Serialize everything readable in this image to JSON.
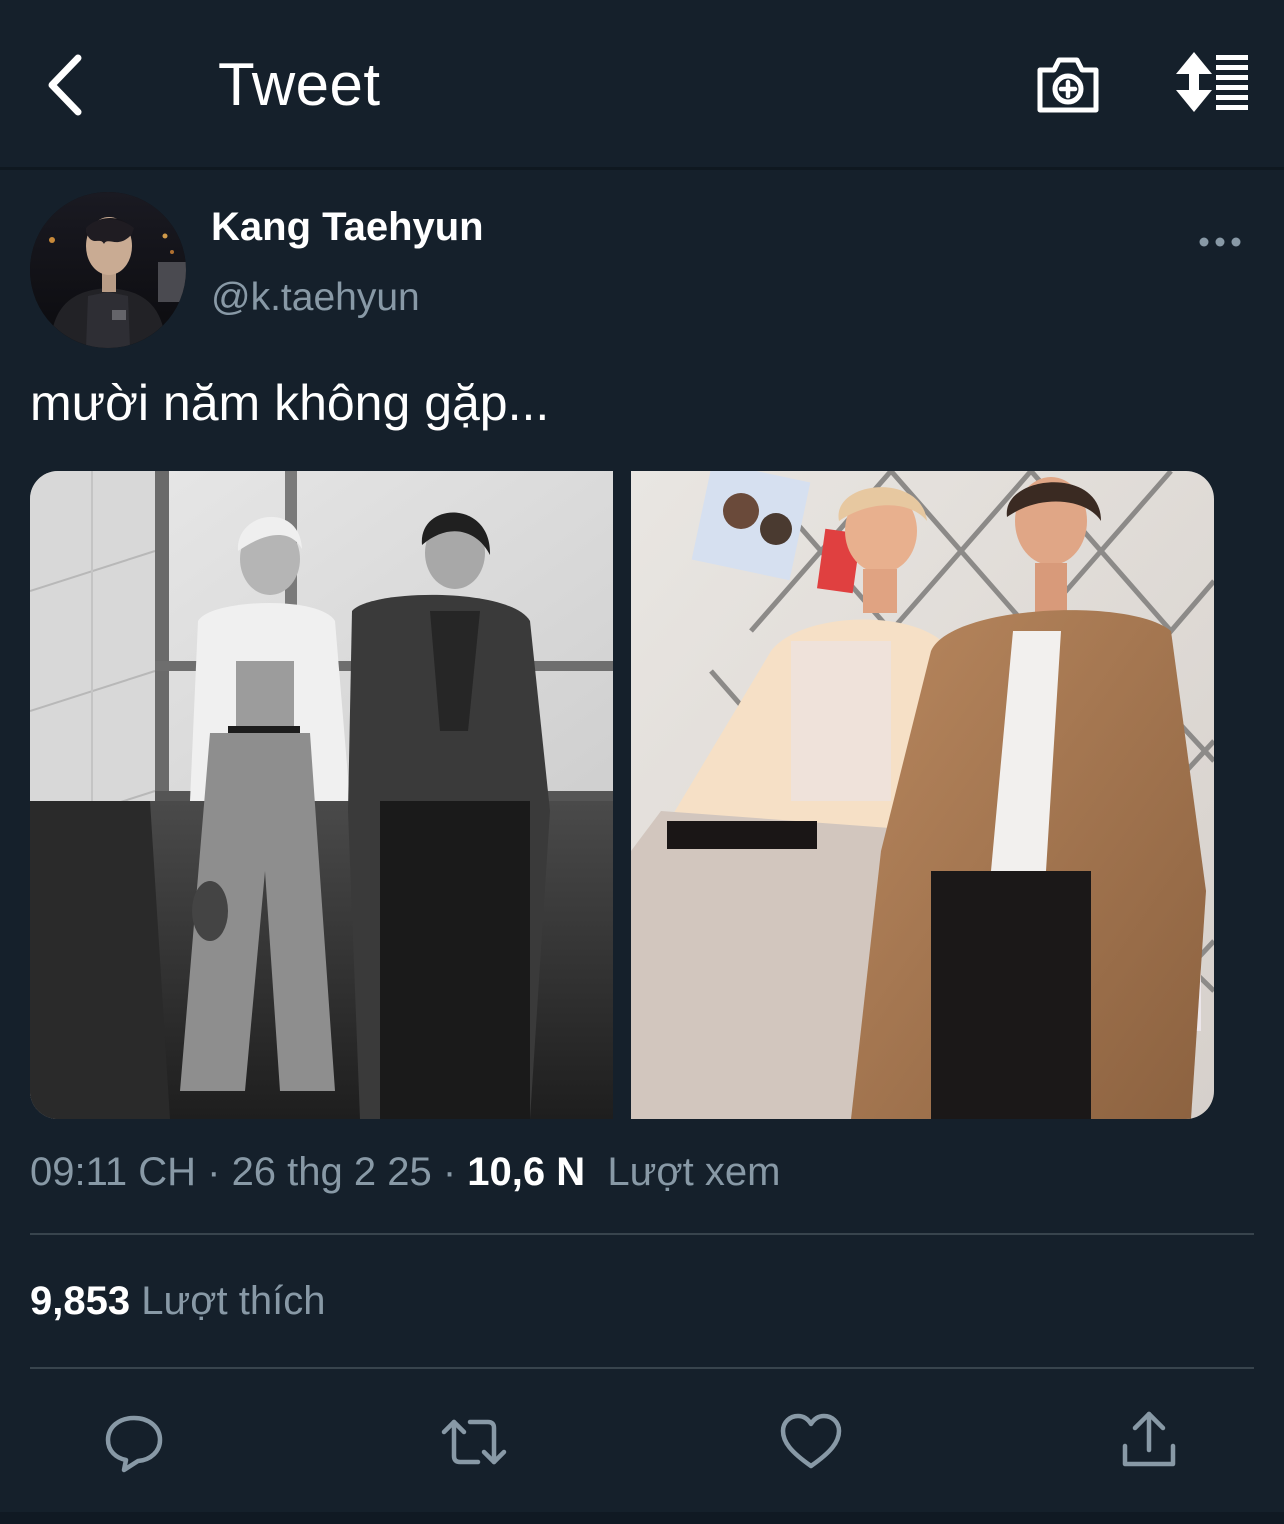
{
  "header": {
    "title": "Tweet",
    "back_icon": "chevron-left-icon",
    "camera_icon": "camera-plus-icon",
    "sort_icon": "sort-list-icon"
  },
  "tweet": {
    "author": {
      "name": "Kang Taehyun",
      "handle": "@k.taehyun"
    },
    "text": "mười năm không gặp...",
    "photos": [
      {
        "name": "photo-1",
        "style": "black-and-white"
      },
      {
        "name": "photo-2",
        "style": "color"
      }
    ],
    "meta": {
      "time": "09:11 CH",
      "separator": " · ",
      "date": "26 thg 2 25",
      "views_count": "10,6 N",
      "views_label": "Lượt xem"
    },
    "likes": {
      "count": "9,853",
      "label": "Lượt thích"
    },
    "actions": [
      {
        "name": "reply",
        "icon": "reply-icon"
      },
      {
        "name": "retweet",
        "icon": "retweet-icon"
      },
      {
        "name": "like",
        "icon": "heart-icon"
      },
      {
        "name": "share",
        "icon": "share-icon"
      }
    ]
  },
  "colors": {
    "background": "#15202b",
    "text_primary": "#ffffff",
    "text_secondary": "#8899a6",
    "divider": "#38444d"
  }
}
